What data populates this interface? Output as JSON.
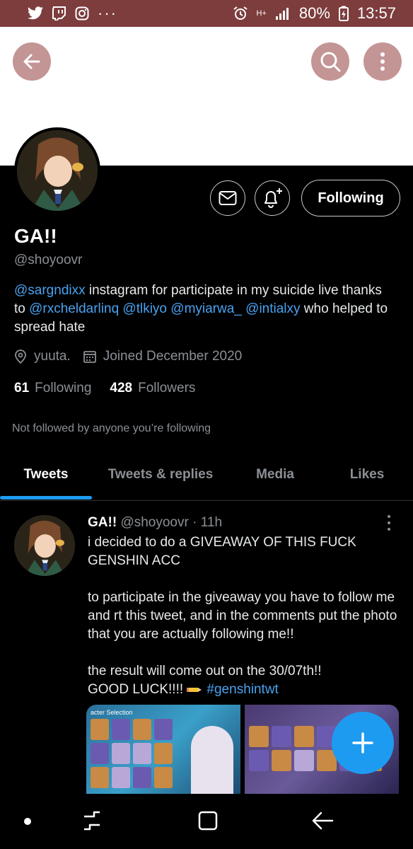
{
  "status_bar": {
    "icons_left": [
      "twitter-icon",
      "twitch-icon",
      "instagram-icon"
    ],
    "more": "···",
    "network": "H+",
    "battery": "80%",
    "time": "13:57"
  },
  "profile": {
    "name": "GA!!",
    "handle": "@shoyoovr",
    "bio_parts": {
      "mention1": "@sargndixx",
      "text1": " instagram for participate in my suicide live thanks to ",
      "mention2": "@rxcheldarlinq",
      "sep1": " ",
      "mention3": "@tlkiyo",
      "sep2": " ",
      "mention4": "@myiarwa_",
      "sep3": " ",
      "mention5": "@intialxy",
      "text2": " who helped to spread hate"
    },
    "location": "yuuta.",
    "joined": "Joined December 2020",
    "following_count": "61",
    "following_label": "Following",
    "followers_count": "428",
    "followers_label": "Followers",
    "not_followed": "Not followed by anyone you’re following",
    "follow_button": "Following"
  },
  "tabs": [
    "Tweets",
    "Tweets & replies",
    "Media",
    "Likes"
  ],
  "tweet": {
    "name": "GA!!",
    "handle": "@shoyoovr",
    "sep": " · ",
    "time": "11h",
    "text": "i decided to do a GIVEAWAY OF THIS FUCK GENSHIN ACC\n\nto participate in the giveaway you have to follow me and rt this tweet, and in the comments put the photo that you are actually following me!!\n\n the result will come out on the 30/07th!!\n GOOD LUCK!!!! ",
    "hashtag": "#genshintwt",
    "media1_label": "acter Selection"
  },
  "colors": {
    "accent": "#1d9bf0",
    "status_bar": "#7d3d3d",
    "header_buttons": "#c49595"
  }
}
